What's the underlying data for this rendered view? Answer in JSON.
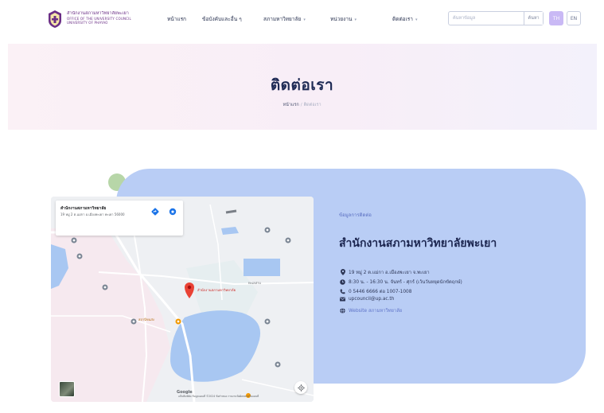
{
  "header": {
    "logo": {
      "line1": "สำนักงานสภามหาวิทยาลัยพะเยา",
      "line2": "OFFICE OF THE UNIVERSITY COUNCIL",
      "line3": "UNIVERSITY OF PHAYAO"
    },
    "nav": [
      {
        "label": "หน้าแรก",
        "has_dropdown": false
      },
      {
        "label": "ข้อบังคับและอื่น ๆ",
        "has_dropdown": false
      },
      {
        "label": "สภามหาวิทยาลัย",
        "has_dropdown": true
      },
      {
        "label": "หน่วยงาน",
        "has_dropdown": true
      },
      {
        "label": "ติดต่อเรา",
        "has_dropdown": true
      }
    ],
    "search": {
      "placeholder": "ค้นหาข้อมูล",
      "button_label": "ค้นหา"
    },
    "languages": [
      {
        "label": "TH",
        "active": true
      },
      {
        "label": "EN",
        "active": false
      }
    ]
  },
  "hero": {
    "title": "ติดต่อเรา",
    "breadcrumb": {
      "home": "หน้าแรก",
      "separator": "/",
      "current": "ติดต่อเรา"
    }
  },
  "contact": {
    "kicker": "ข้อมูลการติดต่อ",
    "title": "สำนักงานสภามหาวิทยาลัยพะเยา",
    "items": [
      {
        "icon": "location-pin-icon",
        "text": "19 หมู่ 2 ต.แม่กา อ.เมืองพะเยา จ.พะเยา"
      },
      {
        "icon": "clock-icon",
        "text": "8:30 น. - 16:30 น. จันทร์ - ศุกร์ (เว้นวันหยุดนักขัตฤกษ์)"
      },
      {
        "icon": "phone-icon",
        "text": "0 5446 6666 ต่อ 1007-1008"
      },
      {
        "icon": "mail-icon",
        "text": "upcouncil@up.ac.th"
      },
      {
        "icon": "globe-icon",
        "text": "Website สภามหาวิทยาลัย"
      }
    ]
  },
  "map": {
    "infocard": {
      "name": "สำนักงานสภามหาวิทยาลัย",
      "address": "19 หมู่ 2 ต.แม่กา อ.เมืองพะเยา พะเยา 56000"
    },
    "pin_label": "สำนักงานสภามหาวิทยาลัย",
    "labels": [
      "ทะเลสาบ",
      "สถานีขนส่ง"
    ],
    "google": "Google",
    "attribution": "แป้นพิมพ์ลัด  ข้อมูลแผนที่ ©2024  ข้อกำหนด  รายงานข้อผิดพลาดในแผนที่"
  },
  "colors": {
    "brand_purple": "#6b2f86",
    "card_blue": "#b9cdf5",
    "heading_navy": "#1c2650",
    "accent_link": "#5f74c9",
    "lang_active": "#c9b9f5",
    "map_water": "#a8c7f2",
    "map_pin": "#e94235"
  }
}
